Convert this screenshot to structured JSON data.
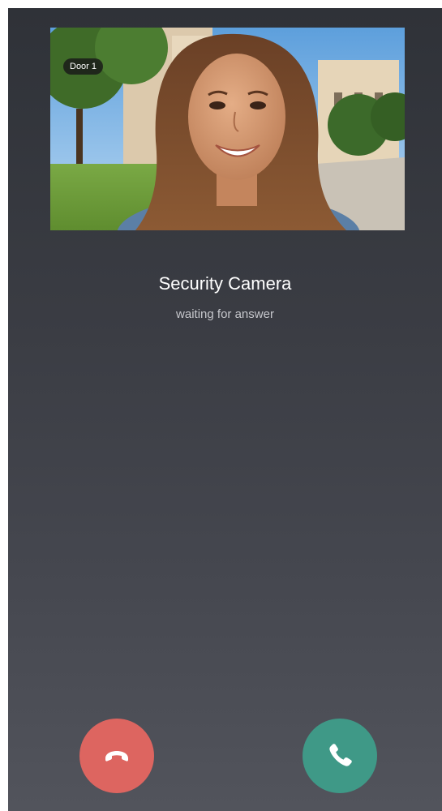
{
  "camera": {
    "label": "Door 1"
  },
  "caller": {
    "name": "Security Camera",
    "status": "waiting for answer"
  },
  "actions": {
    "decline_icon": "phone-hangup-icon",
    "accept_icon": "phone-icon"
  },
  "colors": {
    "decline": "#dd6560",
    "accept": "#3f9987",
    "background_top": "#2f3238",
    "background_bottom": "#52545c"
  }
}
